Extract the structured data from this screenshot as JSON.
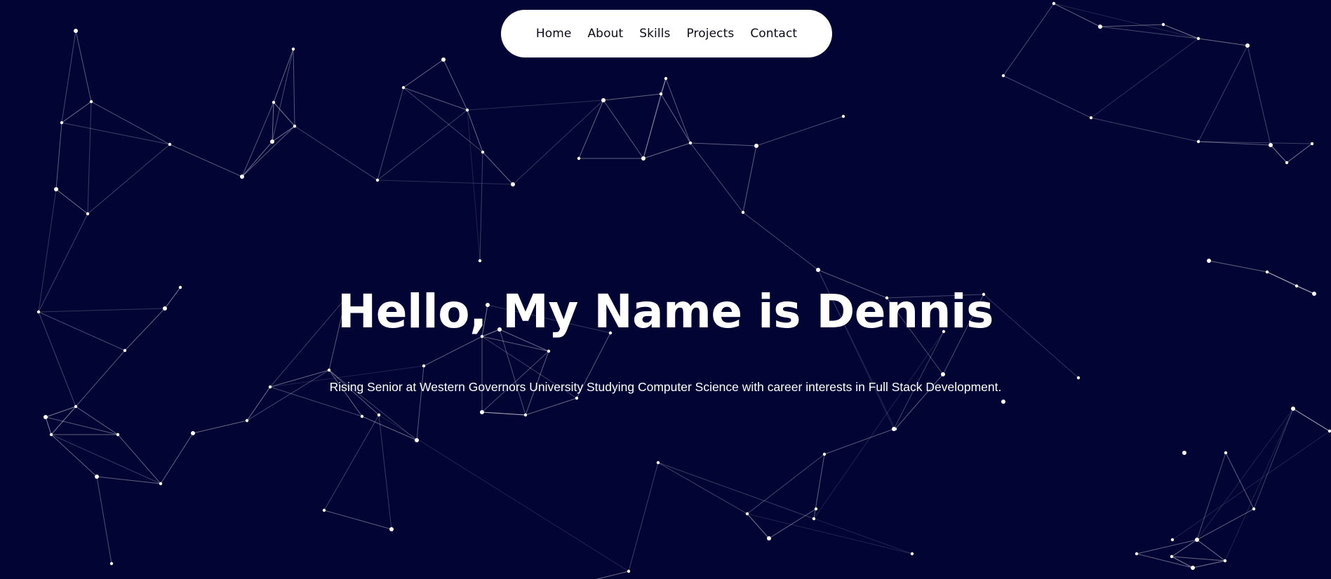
{
  "colors": {
    "background": "#020534",
    "nav_background": "#ffffff",
    "nav_text": "#0b0b1a",
    "text": "#ffffff",
    "particle": "#ffffff"
  },
  "nav": {
    "items": [
      {
        "label": "Home"
      },
      {
        "label": "About"
      },
      {
        "label": "Skills"
      },
      {
        "label": "Projects"
      },
      {
        "label": "Contact"
      }
    ]
  },
  "hero": {
    "title": "Hello, My Name is Dennis",
    "subtitle": "Rising Senior at Western Governors University Studying Computer Science with career interests in Full Stack Development."
  },
  "background": {
    "effect": "particle-network"
  }
}
